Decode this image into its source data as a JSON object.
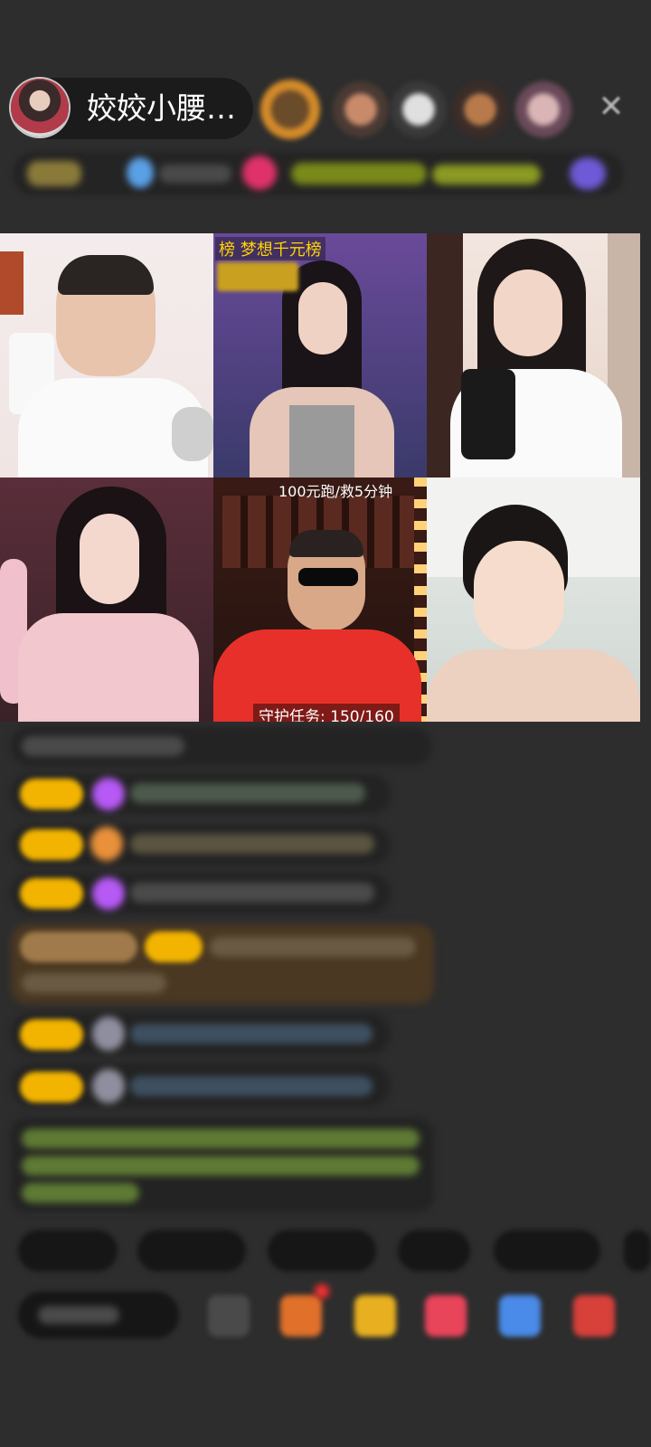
{
  "header": {
    "host_name": "姣姣小腰…",
    "close_icon": "close-icon"
  },
  "video_grid": {
    "tile2_banner": "榜 梦想千元榜",
    "tile5_top_text": "100元跑/救5分钟",
    "tile5_task_text": "守护任务: 150/160"
  },
  "colors": {
    "background": "#2d2d2d",
    "badge_yellow": "#f2b400",
    "gift_purple": "#b659f5",
    "chat_green": "#8ec63f",
    "overlay_yellow": "#ffd400"
  }
}
